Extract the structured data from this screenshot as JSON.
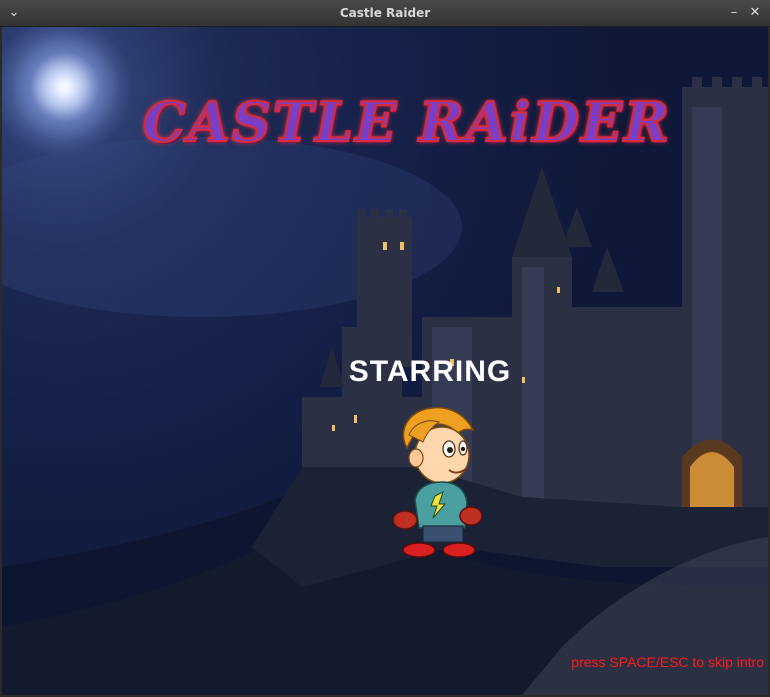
{
  "window": {
    "title": "Castle Raider",
    "menu_icon": "chevron-down-icon",
    "minimize_icon": "minimize-icon",
    "close_icon": "close-icon"
  },
  "game": {
    "logo_text": "CASTLE RAiDER",
    "starring_label": "STARRING",
    "skip_hint": "press SPACE/ESC to skip intro",
    "colors": {
      "logo_fill": "#7a3fc4",
      "logo_outline": "#d82a3a",
      "hint_text": "#ff1a1a",
      "sky": "#16214a"
    }
  }
}
